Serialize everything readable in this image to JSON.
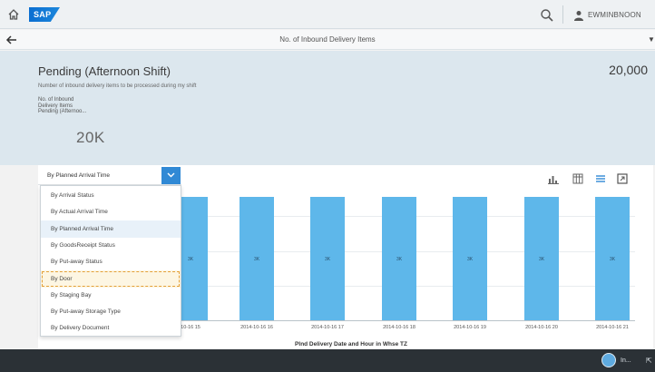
{
  "shell": {
    "logo_text": "SAP",
    "user_name": "EWMINBNOON"
  },
  "subheader": {
    "title": "No. of Inbound Delivery Items"
  },
  "kpi": {
    "heading": "Pending (Afternoon Shift)",
    "value": "20,000",
    "description": "Number of inbound delivery items to be processed during my shift",
    "tile_lines": [
      "No. of Inbound",
      "Delivery Items",
      "Pending (Afternoo..."
    ],
    "tile_value": "20K"
  },
  "dimension_select": {
    "selected": "By Planned Arrival Time",
    "options": [
      "By Arrival Status",
      "By Actual Arrival Time",
      "By Planned Arrival Time",
      "By GoodsReceipt Status",
      "By Put-away Status",
      "By Door",
      "By Staging Bay",
      "By Put-away Storage Type",
      "By Delivery Document"
    ],
    "highlighted_index": 2,
    "focused_index": 5
  },
  "chart_data": {
    "type": "bar",
    "categories": [
      "2014-10-16 15",
      "2014-10-16 16",
      "2014-10-16 17",
      "2014-10-16 18",
      "2014-10-16 19",
      "2014-10-16 20",
      "2014-10-16 21"
    ],
    "values": [
      3000,
      3000,
      3000,
      3000,
      3000,
      3000,
      3000
    ],
    "data_labels": [
      "3K",
      "3K",
      "3K",
      "3K",
      "3K",
      "3K",
      "3K"
    ],
    "xlabel": "Plnd Delivery Date and Hour in Whse TZ",
    "ylabel": "",
    "ylim": [
      0,
      4000
    ],
    "bar_color": "#5eb7ea",
    "grid": true,
    "first_tick_visible": "10-16 15"
  },
  "footer": {
    "badge_text": "In..."
  },
  "colors": {
    "shell_bg": "#eef1f3",
    "kpi_bg": "#dce7ee",
    "accent": "#3089d5",
    "footer_bg": "#2b3136"
  }
}
